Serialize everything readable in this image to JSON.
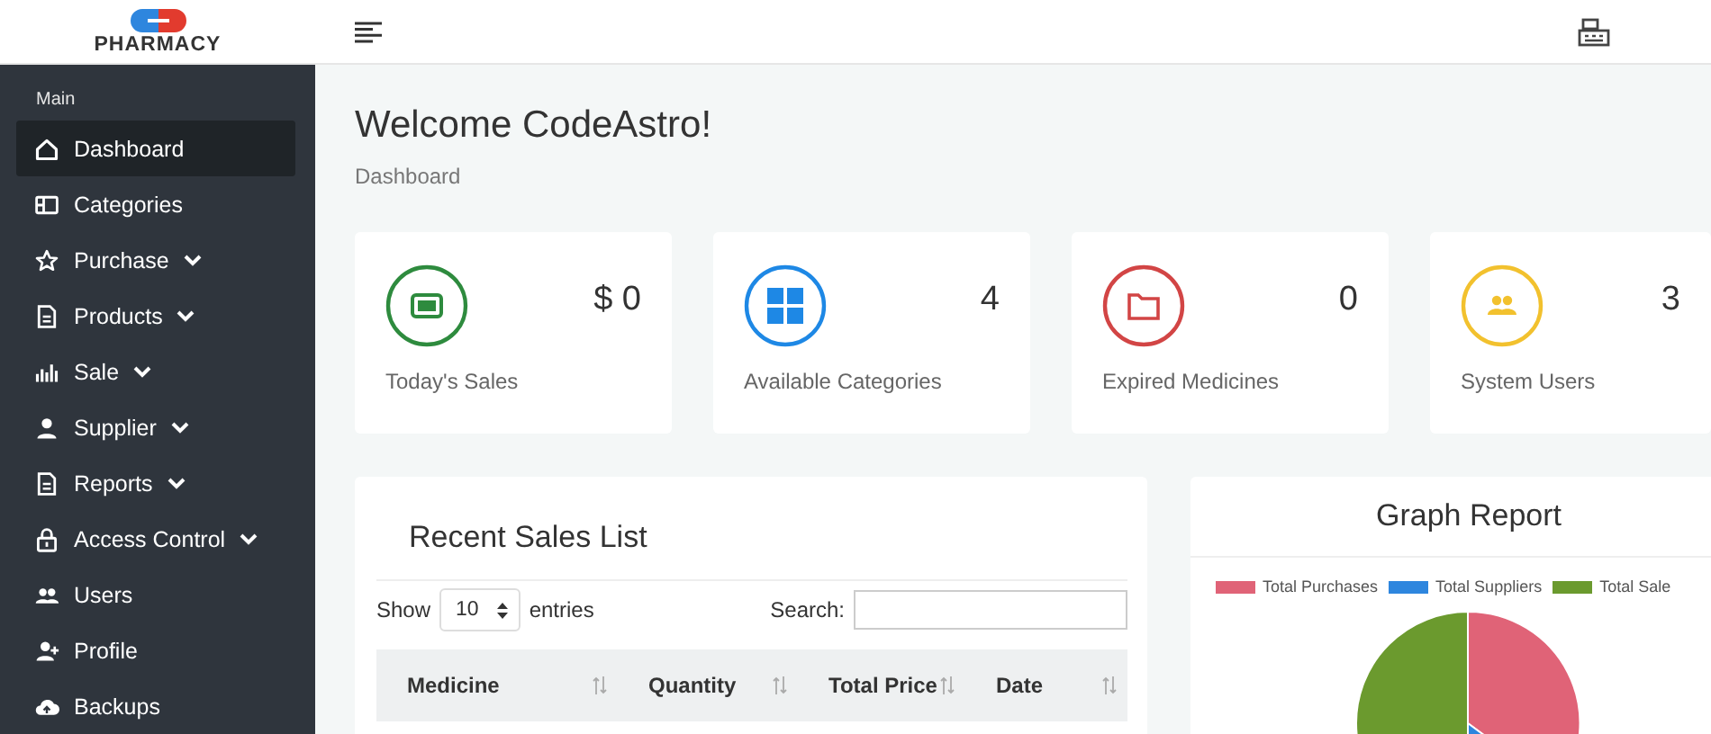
{
  "logo": {
    "text": "PHARMACY"
  },
  "sidebar": {
    "section": "Main",
    "items": [
      {
        "label": "Dashboard",
        "kind": "home",
        "expandable": false,
        "selected": true
      },
      {
        "label": "Categories",
        "kind": "columns",
        "expandable": false,
        "selected": false
      },
      {
        "label": "Purchase",
        "kind": "star",
        "expandable": true,
        "selected": false
      },
      {
        "label": "Products",
        "kind": "file",
        "expandable": true,
        "selected": false
      },
      {
        "label": "Sale",
        "kind": "bars",
        "expandable": true,
        "selected": false
      },
      {
        "label": "Supplier",
        "kind": "user",
        "expandable": true,
        "selected": false
      },
      {
        "label": "Reports",
        "kind": "file",
        "expandable": true,
        "selected": false
      },
      {
        "label": "Access Control",
        "kind": "lock",
        "expandable": true,
        "selected": false
      },
      {
        "label": "Users",
        "kind": "users",
        "expandable": false,
        "selected": false
      },
      {
        "label": "Profile",
        "kind": "user-plus",
        "expandable": false,
        "selected": false
      },
      {
        "label": "Backups",
        "kind": "cloud",
        "expandable": false,
        "selected": false
      }
    ]
  },
  "page": {
    "title": "Welcome CodeAstro!",
    "breadcrumb": "Dashboard"
  },
  "stat_cards": [
    {
      "value": "$ 0",
      "label": "Today's Sales",
      "kind": "cash",
      "color": "#2e8b3e"
    },
    {
      "value": "4",
      "label": "Available Categories",
      "kind": "grid",
      "color": "#1e88e5"
    },
    {
      "value": "0",
      "label": "Expired Medicines",
      "kind": "folder",
      "color": "#d24545"
    },
    {
      "value": "3",
      "label": "System Users",
      "kind": "users",
      "color": "#f2c12e"
    }
  ],
  "sales_list": {
    "title": "Recent Sales List",
    "show_label": "Show",
    "page_size": "10",
    "entries_label": "entries",
    "search_label": "Search:",
    "columns": [
      "Medicine",
      "Quantity",
      "Total Price",
      "Date"
    ]
  },
  "graph": {
    "title": "Graph Report",
    "legend": [
      {
        "label": "Total Purchases",
        "color": "#e06377"
      },
      {
        "label": "Total Suppliers",
        "color": "#2e86de"
      },
      {
        "label": "Total Sale",
        "color": "#6b9a2e"
      }
    ]
  }
}
